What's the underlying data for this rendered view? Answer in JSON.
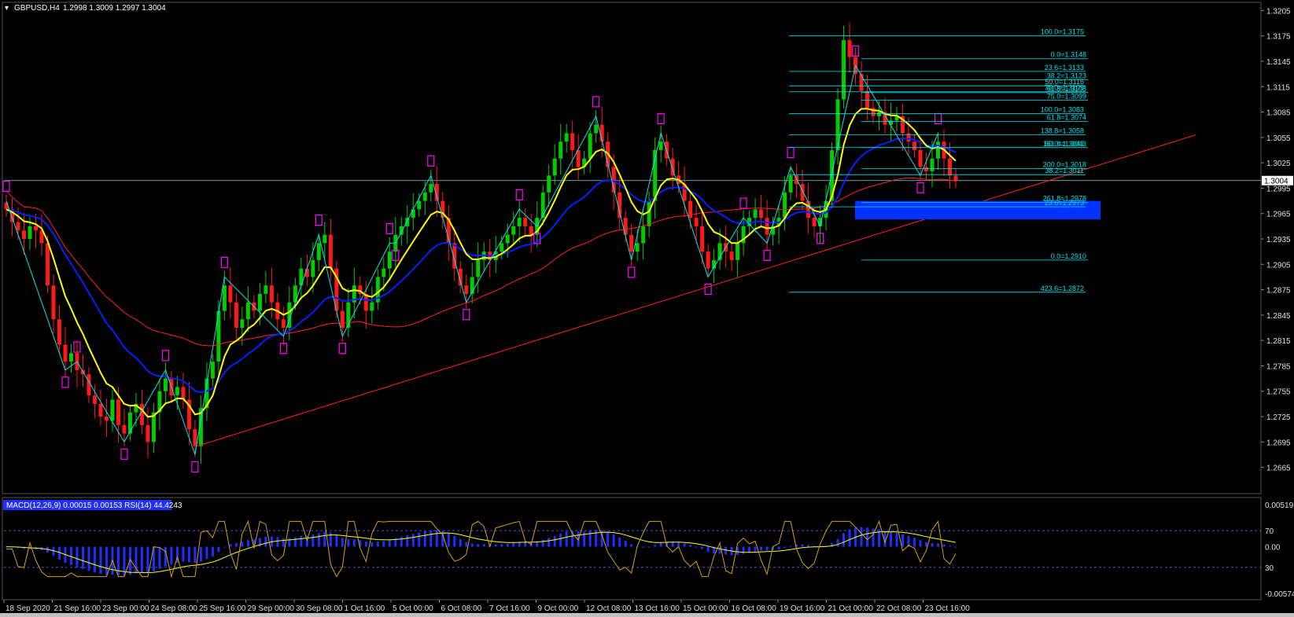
{
  "header": {
    "symbol": "GBPUSD,H4",
    "ohlc": "1.2998 1.3009 1.2997 1.3004"
  },
  "colors": {
    "background": "#000000",
    "bull": "#00cc00",
    "bear": "#ff1a1a",
    "ma_fast": "#ffff00",
    "ma_mid": "#0022ff",
    "ma_slow": "#ff2020",
    "zigzag": "#00e5ee",
    "fractal": "#ff00ff",
    "grid_text": "#e0e0e0",
    "price_tag_bg": "#ffffff",
    "zone": "#0033ff",
    "macd_hist": "#1f2fff",
    "rsi": "#d4a017",
    "signal": "#ffff00"
  },
  "chart_data": [
    {
      "type": "candlestick",
      "title": "GBPUSD,H4",
      "y_ticks": [
        "1.3205",
        "1.3175",
        "1.3145",
        "1.3115",
        "1.3085",
        "1.3055",
        "1.3025",
        "1.2995",
        "1.2965",
        "1.2935",
        "1.2905",
        "1.2875",
        "1.2845",
        "1.2815",
        "1.2785",
        "1.2755",
        "1.2725",
        "1.2695",
        "1.2665"
      ],
      "ylim": [
        1.266,
        1.321
      ],
      "current_price": "1.3004",
      "x_labels": [
        "18 Sep 2020",
        "21 Sep 16:00",
        "23 Sep 00:00",
        "24 Sep 08:00",
        "25 Sep 16:00",
        "29 Sep 00:00",
        "30 Sep 08:00",
        "1 Oct 16:00",
        "5 Oct 00:00",
        "6 Oct 08:00",
        "7 Oct 16:00",
        "9 Oct 00:00",
        "12 Oct 08:00",
        "13 Oct 16:00",
        "15 Oct 00:00",
        "16 Oct 08:00",
        "19 Oct 16:00",
        "21 Oct 00:00",
        "22 Oct 08:00",
        "23 Oct 16:00"
      ],
      "close": [
        1.297,
        1.2955,
        1.2945,
        1.2935,
        1.295,
        1.2945,
        1.293,
        1.288,
        1.284,
        1.281,
        1.279,
        1.28,
        1.278,
        1.2775,
        1.275,
        1.274,
        1.2725,
        1.272,
        1.2745,
        1.2715,
        1.2705,
        1.273,
        1.274,
        1.2715,
        1.2695,
        1.273,
        1.2755,
        1.277,
        1.275,
        1.276,
        1.2745,
        1.271,
        1.269,
        1.2735,
        1.277,
        1.279,
        1.285,
        1.288,
        1.286,
        1.283,
        1.284,
        1.286,
        1.285,
        1.287,
        1.288,
        1.286,
        1.284,
        1.283,
        1.286,
        1.288,
        1.29,
        1.289,
        1.291,
        1.293,
        1.294,
        1.29,
        1.285,
        1.283,
        1.286,
        1.288,
        1.287,
        1.285,
        1.286,
        1.289,
        1.29,
        1.292,
        1.294,
        1.295,
        1.296,
        1.297,
        1.298,
        1.299,
        1.3,
        1.298,
        1.296,
        1.293,
        1.29,
        1.288,
        1.287,
        1.289,
        1.291,
        1.292,
        1.291,
        1.292,
        1.293,
        1.294,
        1.295,
        1.296,
        1.295,
        1.294,
        1.296,
        1.299,
        1.301,
        1.303,
        1.305,
        1.306,
        1.304,
        1.302,
        1.303,
        1.306,
        1.307,
        1.305,
        1.302,
        1.299,
        1.296,
        1.294,
        1.292,
        1.293,
        1.295,
        1.298,
        1.304,
        1.305,
        1.303,
        1.301,
        1.3,
        1.298,
        1.296,
        1.295,
        1.292,
        1.29,
        1.291,
        1.293,
        1.292,
        1.291,
        1.293,
        1.295,
        1.296,
        1.297,
        1.296,
        1.294,
        1.295,
        1.296,
        1.299,
        1.301,
        1.3,
        1.298,
        1.296,
        1.295,
        1.296,
        1.298,
        1.304,
        1.31,
        1.317,
        1.315,
        1.313,
        1.311,
        1.309,
        1.308,
        1.3085,
        1.307,
        1.3075,
        1.308,
        1.306,
        1.305,
        1.304,
        1.302,
        1.3015,
        1.303,
        1.305,
        1.303,
        1.301,
        1.3004
      ],
      "series": [
        {
          "name": "",
          "kind": "ema_fast"
        },
        {
          "name": "",
          "kind": "ema_mid"
        },
        {
          "name": "",
          "kind": "sma_slow"
        }
      ],
      "fib_levels": [
        {
          "label": "100.0=1.3175",
          "value": 1.3175
        },
        {
          "label": "0.0=1.3148",
          "value": 1.3148
        },
        {
          "label": "23.6=1.3133",
          "value": 1.3133
        },
        {
          "label": "38.2=1.3123",
          "value": 1.3123
        },
        {
          "label": "50.0=1.3116",
          "value": 1.3116
        },
        {
          "label": "61.8=1.3108",
          "value": 1.3108
        },
        {
          "label": "75.0=1.3109",
          "value": 1.3109
        },
        {
          "label": "75.0=1.3099",
          "value": 1.3099
        },
        {
          "label": "100.0=1.3083",
          "value": 1.3083
        },
        {
          "label": "61.8=1.3074",
          "value": 1.3074
        },
        {
          "label": "138.8=1.3058",
          "value": 1.3058
        },
        {
          "label": "161.8=1.3043",
          "value": 1.3043
        },
        {
          "label": "50.0=1.3043",
          "value": 1.3043
        },
        {
          "label": "200.0=1.3018",
          "value": 1.3018
        },
        {
          "label": "38.2=1.3011",
          "value": 1.3011
        },
        {
          "label": "261.8=1.2978",
          "value": 1.2978
        },
        {
          "label": "23.6=1.2973",
          "value": 1.2973
        },
        {
          "label": "0.0=1.2910",
          "value": 1.291
        },
        {
          "label": "423.6=1.2872",
          "value": 1.2872
        }
      ],
      "zone": {
        "top": 1.298,
        "bottom": 1.2958
      },
      "trendline": [
        {
          "x": "25 Sep 00:00",
          "y": 1.269
        },
        {
          "x": "23 Oct 20:00",
          "y": 1.3058
        }
      ],
      "grid": false
    },
    {
      "type": "line",
      "title": "MACD(12,26,9) 0.00015 0.00153  RSI(14) 44.4243",
      "y_ticks": [
        "0.00519",
        "70",
        "0.00",
        "30",
        "-0.00574"
      ],
      "ylim": [
        -0.00574,
        0.00519
      ],
      "rsi_levels": [
        70,
        30
      ]
    }
  ]
}
